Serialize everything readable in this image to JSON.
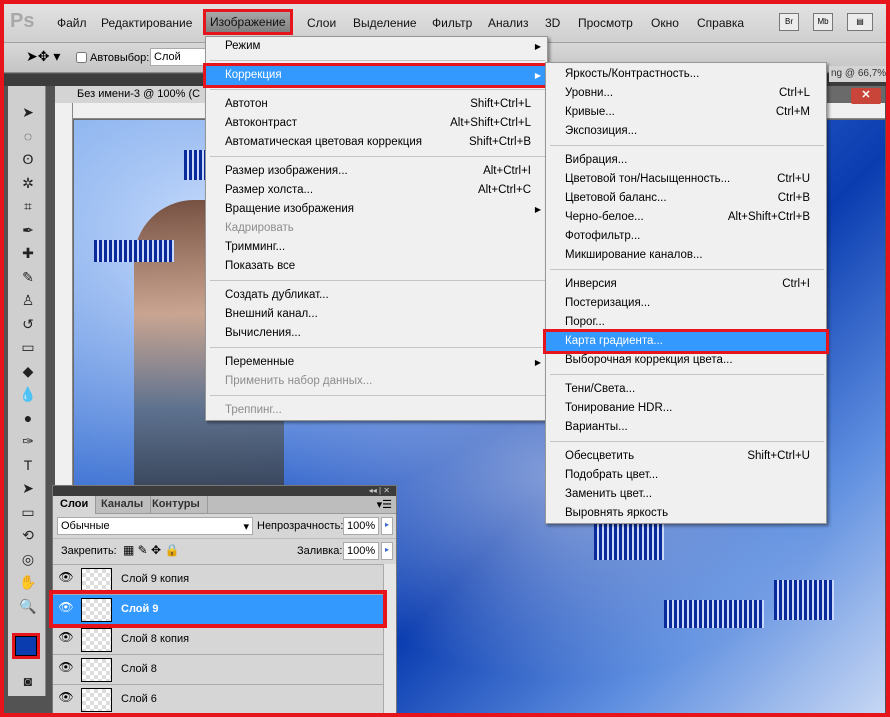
{
  "menubar": {
    "logo": "Ps",
    "items": [
      "Файл",
      "Редактирование",
      "Изображение",
      "Слои",
      "Выделение",
      "Фильтр",
      "Анализ",
      "3D",
      "Просмотр",
      "Окно",
      "Справка"
    ],
    "active": "Изображение",
    "buttons": [
      "Br",
      "Mb",
      "▤"
    ]
  },
  "options": {
    "autoselect_label": "Автовыбор:",
    "autoselect_value": "Слой",
    "window_title_fragment": "ng @ 66,7%"
  },
  "document": {
    "tab_title": "Без имени-3 @ 100% (С"
  },
  "image_menu": [
    {
      "label": "Режим",
      "submenu": true
    },
    {
      "sep": true
    },
    {
      "label": "Коррекция",
      "submenu": true,
      "highlighted": true
    },
    {
      "sep": true
    },
    {
      "label": "Автотон",
      "shortcut": "Shift+Ctrl+L"
    },
    {
      "label": "Автоконтраст",
      "shortcut": "Alt+Shift+Ctrl+L"
    },
    {
      "label": "Автоматическая цветовая коррекция",
      "shortcut": "Shift+Ctrl+B"
    },
    {
      "sep": true
    },
    {
      "label": "Размер изображения...",
      "shortcut": "Alt+Ctrl+I"
    },
    {
      "label": "Размер холста...",
      "shortcut": "Alt+Ctrl+C"
    },
    {
      "label": "Вращение изображения",
      "submenu": true
    },
    {
      "label": "Кадрировать",
      "disabled": true
    },
    {
      "label": "Тримминг..."
    },
    {
      "label": "Показать все"
    },
    {
      "sep": true
    },
    {
      "label": "Создать дубликат..."
    },
    {
      "label": "Внешний канал..."
    },
    {
      "label": "Вычисления..."
    },
    {
      "sep": true
    },
    {
      "label": "Переменные",
      "submenu": true
    },
    {
      "label": "Применить набор данных...",
      "disabled": true
    },
    {
      "sep": true
    },
    {
      "label": "Треппинг...",
      "disabled": true
    }
  ],
  "correction_menu": [
    {
      "label": "Яркость/Контрастность..."
    },
    {
      "label": "Уровни...",
      "shortcut": "Ctrl+L"
    },
    {
      "label": "Кривые...",
      "shortcut": "Ctrl+M"
    },
    {
      "label": "Экспозиция..."
    },
    {
      "sep": true
    },
    {
      "label": "Вибрация..."
    },
    {
      "label": "Цветовой тон/Насыщенность...",
      "shortcut": "Ctrl+U"
    },
    {
      "label": "Цветовой баланс...",
      "shortcut": "Ctrl+B"
    },
    {
      "label": "Черно-белое...",
      "shortcut": "Alt+Shift+Ctrl+B"
    },
    {
      "label": "Фотофильтр..."
    },
    {
      "label": "Микширование каналов..."
    },
    {
      "sep": true
    },
    {
      "label": "Инверсия",
      "shortcut": "Ctrl+I"
    },
    {
      "label": "Постеризация..."
    },
    {
      "label": "Порог..."
    },
    {
      "label": "Карта градиента...",
      "highlighted": true
    },
    {
      "label": "Выборочная коррекция цвета..."
    },
    {
      "sep": true
    },
    {
      "label": "Тени/Света..."
    },
    {
      "label": "Тонирование HDR..."
    },
    {
      "label": "Варианты..."
    },
    {
      "sep": true
    },
    {
      "label": "Обесцветить",
      "shortcut": "Shift+Ctrl+U"
    },
    {
      "label": "Подобрать цвет..."
    },
    {
      "label": "Заменить цвет..."
    },
    {
      "label": "Выровнять яркость"
    }
  ],
  "layers_panel": {
    "tabs": [
      "Слои",
      "Каналы",
      "Контуры"
    ],
    "blend_mode": "Обычные",
    "opacity_label": "Непрозрачность:",
    "opacity": "100%",
    "lock_label": "Закрепить:",
    "fill_label": "Заливка:",
    "fill": "100%",
    "layers": [
      {
        "name": "Слой 9 копия"
      },
      {
        "name": "Слой 9",
        "selected": true
      },
      {
        "name": "Слой 8 копия"
      },
      {
        "name": "Слой 8"
      },
      {
        "name": "Слой 6"
      }
    ]
  },
  "colors": {
    "highlight": "#3399ff",
    "annotation": "#e8141c",
    "foreground": "#0a3cb0"
  }
}
